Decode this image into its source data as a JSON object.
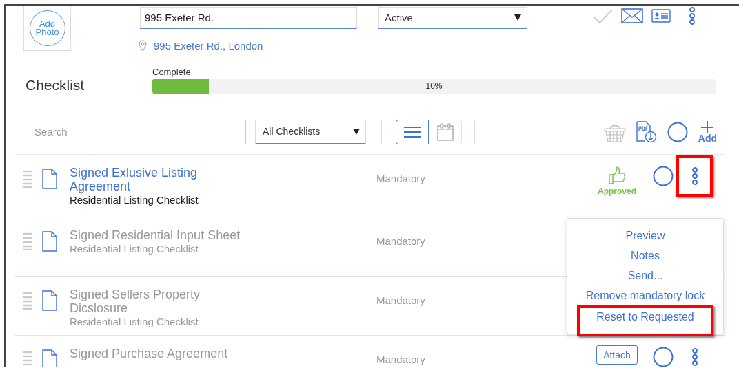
{
  "photo": {
    "label": "Add Photo"
  },
  "address_field": {
    "value": "995 Exeter Rd."
  },
  "status_select": {
    "value": "Active"
  },
  "location": "995 Exeter Rd., London",
  "progress": {
    "label": "Complete",
    "level": 0.1,
    "reading": "10%"
  },
  "title": "Checklist",
  "toolbar": {
    "search": {
      "placeholder": "Search"
    },
    "filter": {
      "value": "All Checklists"
    },
    "views": [
      {
        "kind": "list",
        "selected": true
      },
      {
        "kind": "calendar",
        "selected": false
      }
    ],
    "add_label": "Add"
  },
  "rows": [
    {
      "title": "Signed Exlusive Listing Agreement",
      "checklist": "Residential Listing Checklist",
      "requirement": "Mandatory",
      "dimmed": false,
      "status": {
        "kind": "approved",
        "label": "Approved"
      },
      "highlighted": true
    },
    {
      "title": "Signed Residential Input Sheet",
      "checklist": "Residential Listing Checklist",
      "requirement": "Mandatory",
      "dimmed": true,
      "status": {
        "kind": "none"
      },
      "highlighted": false
    },
    {
      "title": "Signed Sellers Property Dicslosure",
      "checklist": "Residential Listing Checklist",
      "requirement": "Mandatory",
      "dimmed": true,
      "status": {
        "kind": "none"
      },
      "highlighted": false
    },
    {
      "title": "Signed Purchase Agreement",
      "requirement": "Mandatory",
      "dimmed": true,
      "status": {
        "kind": "attach",
        "label": "Attach"
      },
      "highlighted": false
    }
  ],
  "menu": {
    "items": [
      {
        "label": "Preview",
        "highlighted": false
      },
      {
        "label": "Notes",
        "highlighted": false
      },
      {
        "label": "Send...",
        "highlighted": false
      },
      {
        "label": "Remove mandatory lock",
        "highlighted": false
      },
      {
        "label": "Reset to Requested",
        "highlighted": true
      }
    ]
  }
}
